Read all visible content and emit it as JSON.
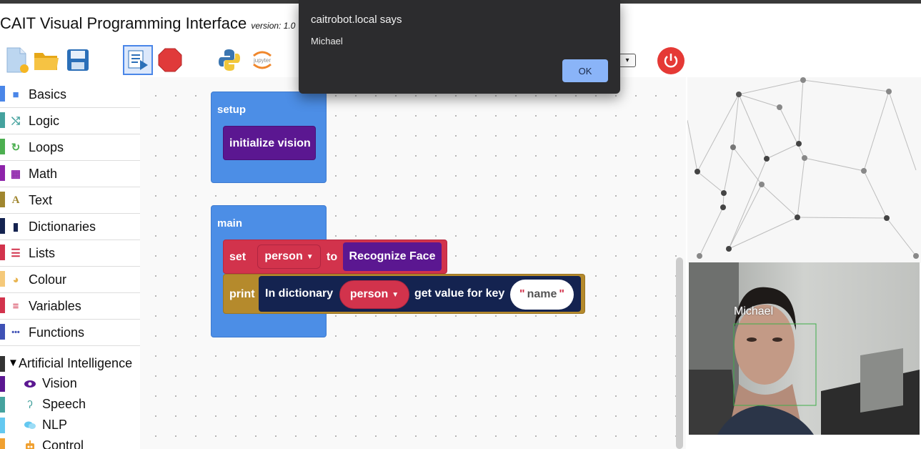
{
  "app": {
    "title": "CAIT Visual Programming Interface",
    "version": "version: 1.0"
  },
  "toolbar": {
    "icons": [
      "new-file-icon",
      "open-folder-icon",
      "save-icon",
      "run-icon",
      "stop-icon",
      "python-icon",
      "jupyter-icon",
      "power-icon"
    ],
    "jupyter_text": "jupyter"
  },
  "sidebar": {
    "categories": [
      {
        "label": "Basics",
        "color": "#4a86e8",
        "icon": "cube-icon",
        "glyph": "■"
      },
      {
        "label": "Logic",
        "color": "#45a29e",
        "icon": "shuffle-icon",
        "glyph": "⤭"
      },
      {
        "label": "Loops",
        "color": "#4caf50",
        "icon": "loop-icon",
        "glyph": "↻"
      },
      {
        "label": "Math",
        "color": "#8e24aa",
        "icon": "calculator-icon",
        "glyph": "▦"
      },
      {
        "label": "Text",
        "color": "#a0862f",
        "icon": "font-icon",
        "glyph": "A"
      },
      {
        "label": "Dictionaries",
        "color": "#142350",
        "icon": "book-icon",
        "glyph": "▮"
      },
      {
        "label": "Lists",
        "color": "#d2334c",
        "icon": "list-icon",
        "glyph": "☰"
      },
      {
        "label": "Colour",
        "color": "#f5c97a",
        "icon": "palette-icon",
        "glyph": "◕"
      },
      {
        "label": "Variables",
        "color": "#d2334c",
        "icon": "bars-icon",
        "glyph": "≡"
      },
      {
        "label": "Functions",
        "color": "#3f51b5",
        "icon": "ellipsis-icon",
        "glyph": "•••"
      }
    ],
    "ai_header": "Artificial Intelligence",
    "ai_items": [
      {
        "label": "Vision",
        "color": "#5b1791",
        "icon": "eye-icon"
      },
      {
        "label": "Speech",
        "color": "#45a29e",
        "icon": "ear-icon"
      },
      {
        "label": "NLP",
        "color": "#64c8f0",
        "icon": "chat-icon"
      },
      {
        "label": "Control",
        "color": "#f0a030",
        "icon": "robot-icon"
      }
    ]
  },
  "workspace": {
    "setup_label": "setup",
    "initialize_vision": "initialize vision",
    "main_label": "main",
    "set_label": "set",
    "variable_name": "person",
    "to_label": "to",
    "recognize_face": "Recognize Face",
    "print_label": "print",
    "in_dictionary": "In dictionary",
    "dict_variable": "person",
    "get_value_for_key": "get value for key",
    "key_open_quote": "\"",
    "key_string": "name",
    "key_close_quote": "\""
  },
  "camera": {
    "face_label": "Michael"
  },
  "dialog": {
    "title": "caitrobot.local says",
    "message": "Michael",
    "ok_label": "OK"
  }
}
